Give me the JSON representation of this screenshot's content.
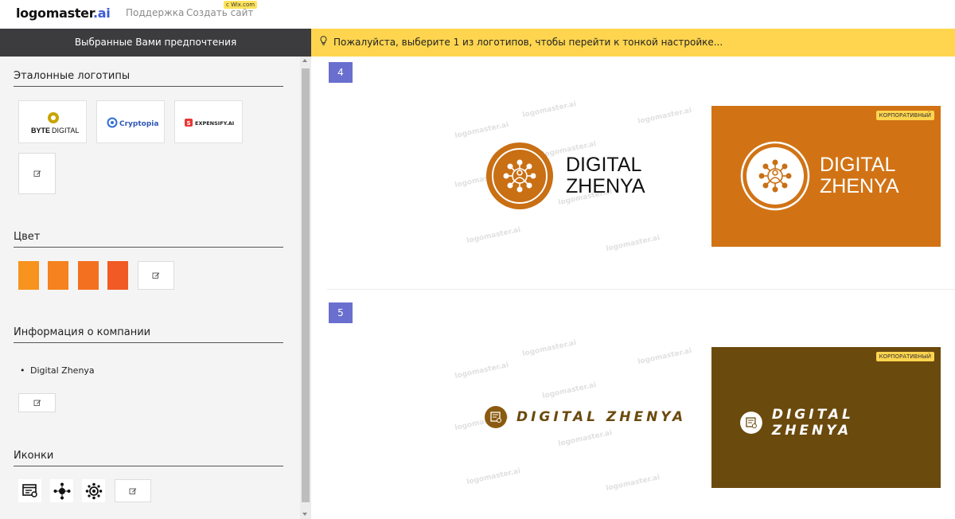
{
  "header": {
    "logo_main": "logomaster",
    "logo_suffix": ".ai",
    "nav": [
      "Поддержка",
      "Создать сайт"
    ],
    "wix_badge": "с Wix.com"
  },
  "sidebar": {
    "title": "Выбранные Вами предпочтения",
    "sections": {
      "ref_logos": "Эталонные логотипы",
      "color": "Цвет",
      "company_info": "Информация о компании",
      "icons": "Иконки"
    },
    "ref_logo_names": [
      "BYTEDIGITAL",
      "Cryptopia",
      "EXPENSIFY.AI"
    ],
    "bytedigital_parts": [
      "BYTE",
      "DIGITAL"
    ],
    "colors": [
      "#f7931e",
      "#f5821f",
      "#f37021",
      "#f15a24"
    ],
    "company_items": [
      "Digital Zhenya"
    ],
    "icon_names": [
      "browser-settings-icon",
      "network-hub-icon",
      "virus-network-icon"
    ]
  },
  "notice": {
    "text": "Пожалуйста, выберите 1 из логотипов, чтобы перейти к тонкой настройке..."
  },
  "watermark": "logomaster.ai",
  "results": [
    {
      "number": "4",
      "badge": "КОРПОРАТИВНЫЙ",
      "line1": "DIGITAL",
      "line2": "ZHENYA",
      "accent": "#c96f14",
      "bg_dark": "#d17315"
    },
    {
      "number": "5",
      "badge": "КОРПОРАТИВНЫЙ",
      "name": "DIGITAL ZHENYA",
      "accent": "#7a4e10",
      "bg_dark": "#6b4a0e"
    }
  ]
}
